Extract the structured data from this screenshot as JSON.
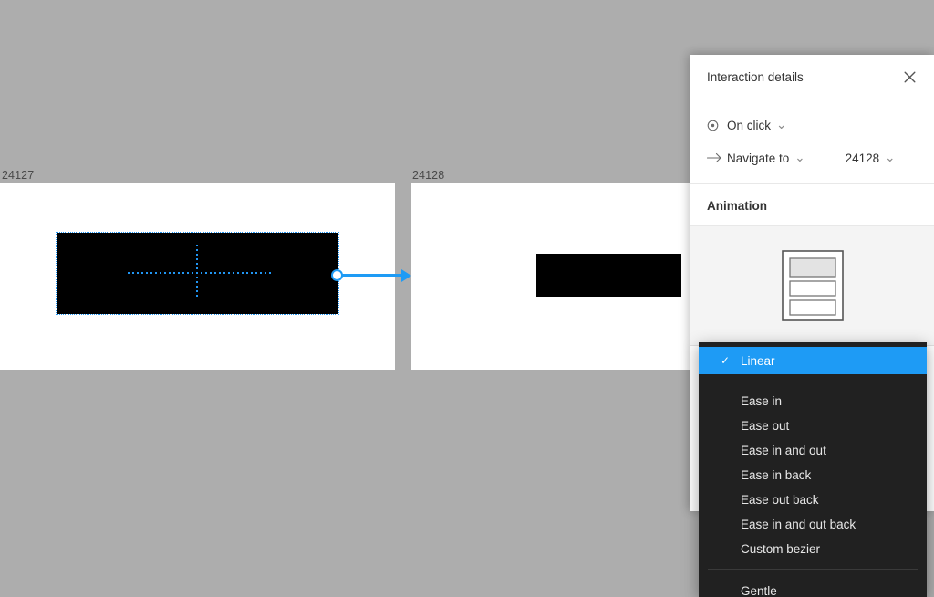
{
  "canvas": {
    "background_color": "#adadad",
    "frames": [
      {
        "label": "24127",
        "shape_fill": "#000000",
        "selected": true
      },
      {
        "label": "24128",
        "shape_fill": "#000000",
        "selected": false
      }
    ],
    "connector": {
      "color": "#1e9bf5",
      "from_frame": "24127",
      "to_frame": "24128"
    },
    "selection_color": "#2196f3"
  },
  "panel": {
    "title": "Interaction details",
    "close_icon": "close-icon",
    "trigger": {
      "icon": "click-target-icon",
      "label": "On click",
      "caret": "⌄"
    },
    "action": {
      "icon": "arrow-right-icon",
      "label": "Navigate to",
      "caret": "⌄",
      "target_value": "24128",
      "target_caret": "⌄"
    },
    "animation_heading": "Animation",
    "preview_icon": "frame-list-preview-icon"
  },
  "easing_dropdown": {
    "selected": "Linear",
    "check_glyph": "✓",
    "highlight_color": "#1e9bf5",
    "background_color": "#212121",
    "items": [
      {
        "label": "Linear",
        "selected": true
      },
      {
        "label": "Ease in",
        "selected": false
      },
      {
        "label": "Ease out",
        "selected": false
      },
      {
        "label": "Ease in and out",
        "selected": false
      },
      {
        "label": "Ease in back",
        "selected": false
      },
      {
        "label": "Ease out back",
        "selected": false
      },
      {
        "label": "Ease in and out back",
        "selected": false
      },
      {
        "label": "Custom bezier",
        "selected": false
      }
    ],
    "group2": [
      {
        "label": "Gentle",
        "selected": false
      }
    ]
  }
}
